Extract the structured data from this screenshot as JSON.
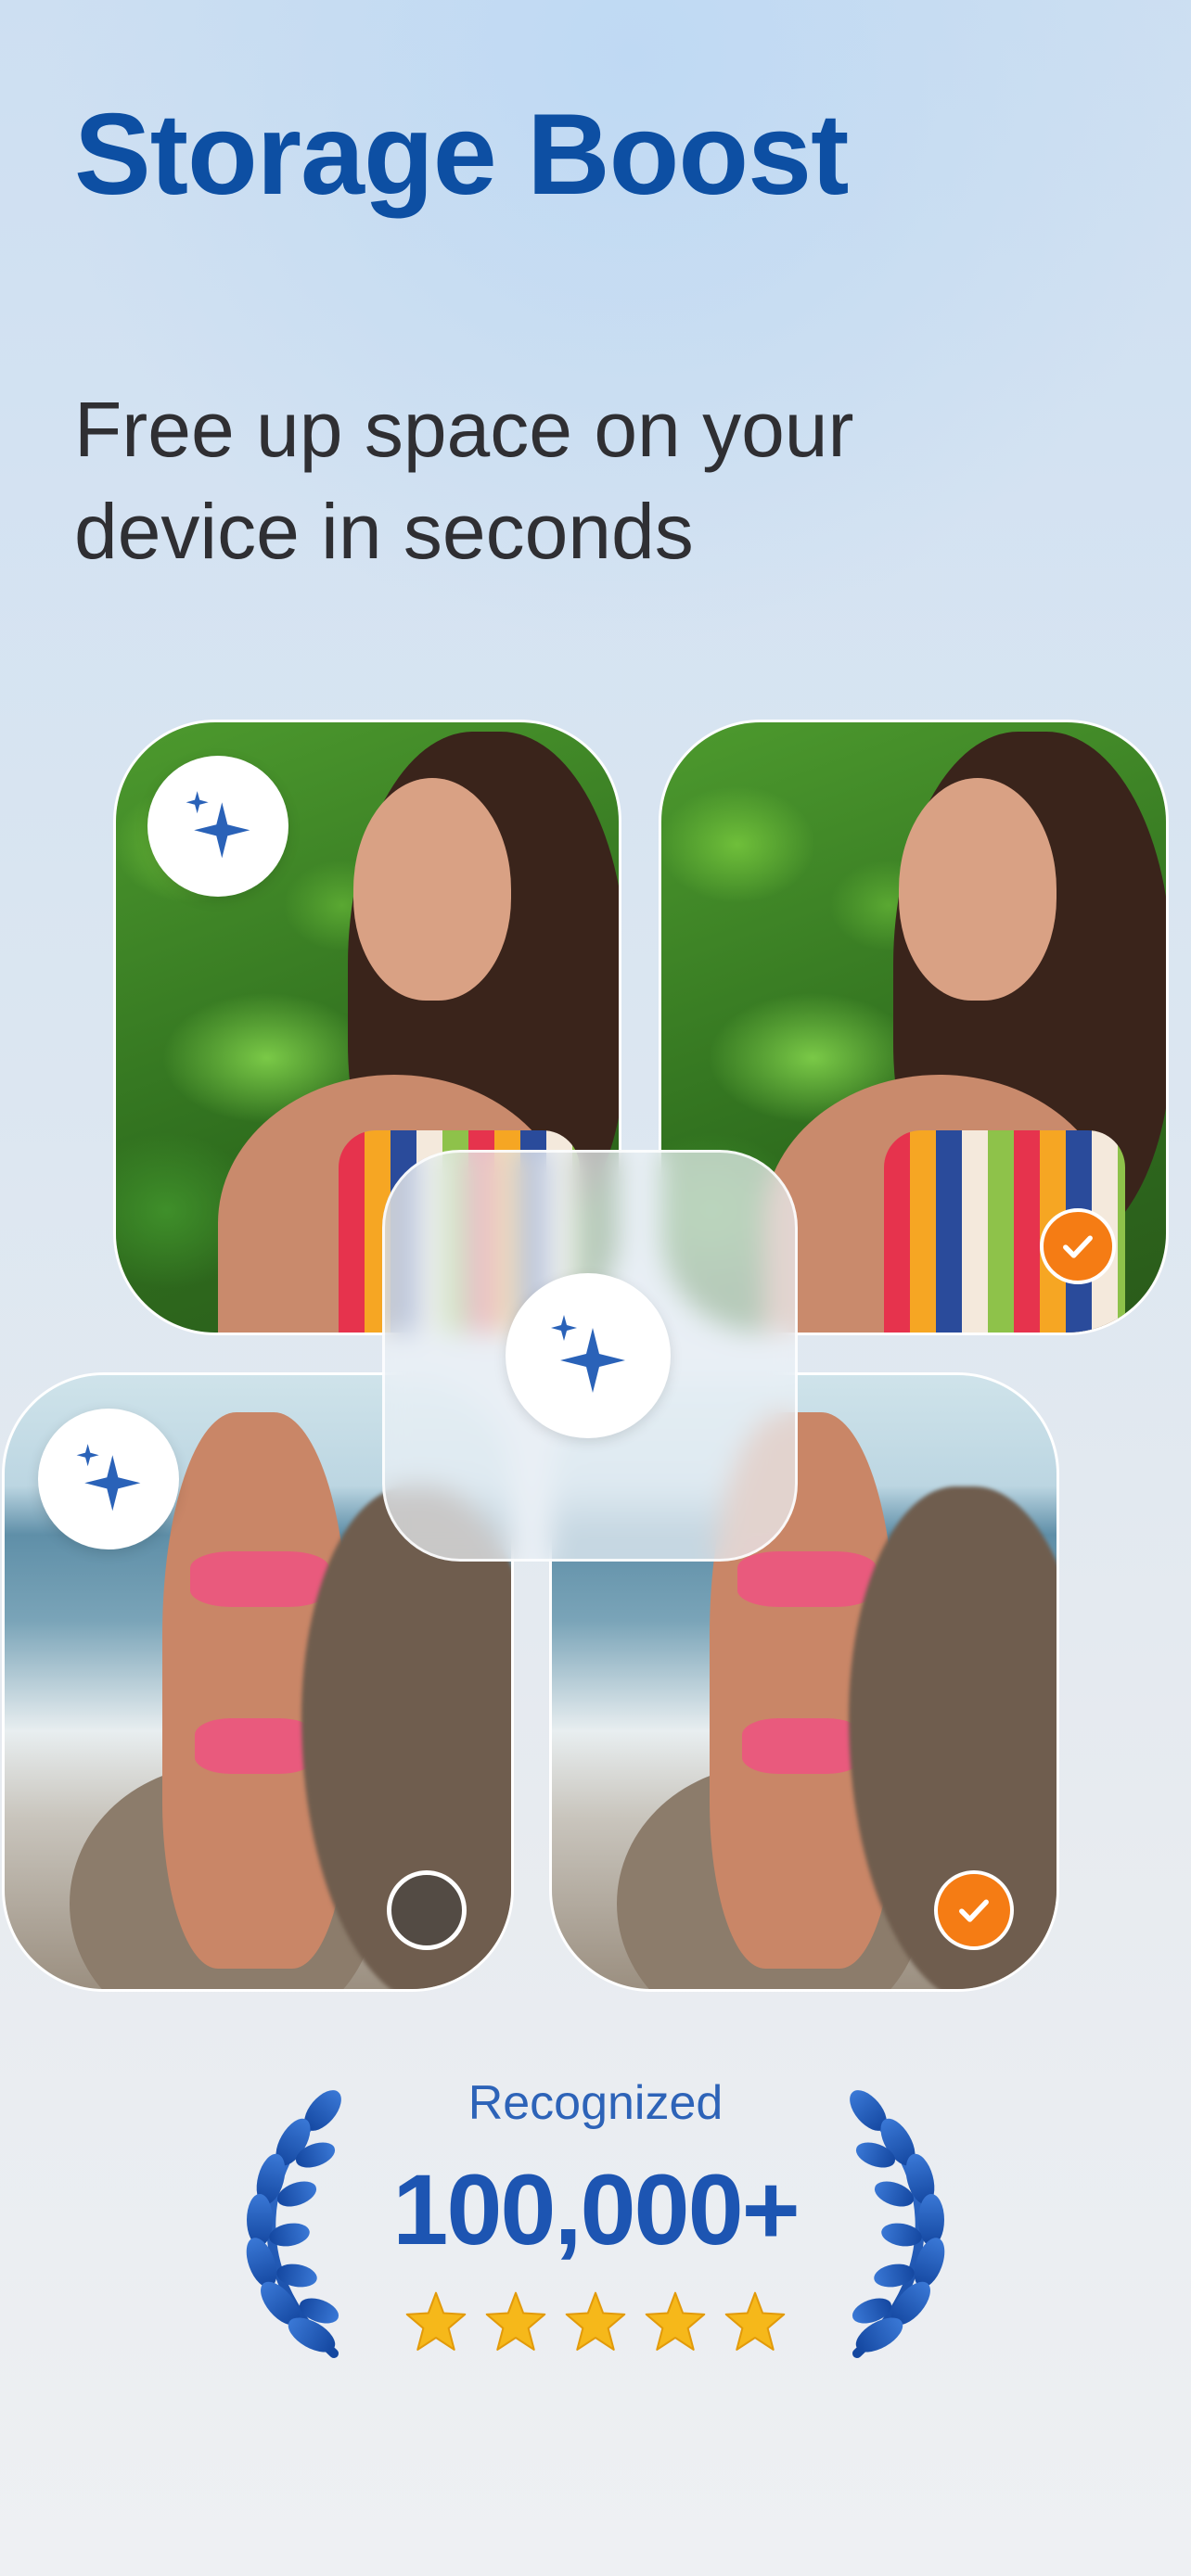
{
  "header": {
    "title": "Storage Boost",
    "subtitle": "Free up space on your device in seconds"
  },
  "colors": {
    "title": "#0d4fa3",
    "accent_blue": "#2d63b8",
    "check_orange": "#f57c14",
    "star_gold": "#f6b81a"
  },
  "icons": {
    "sparkle": "sparkle-icon",
    "check": "checkmark-icon",
    "laurel": "laurel-icon",
    "star": "star-icon"
  },
  "photos": [
    {
      "name": "portrait-original",
      "badge": "sparkle",
      "selected": false
    },
    {
      "name": "portrait-duplicate",
      "badge": "check",
      "selected": true
    },
    {
      "name": "beach-original",
      "badge": "sparkle",
      "selected": false
    },
    {
      "name": "beach-duplicate",
      "badge": "check",
      "selected": true
    }
  ],
  "rating": {
    "label": "Recognized",
    "count": "100,000+",
    "stars": 5
  }
}
